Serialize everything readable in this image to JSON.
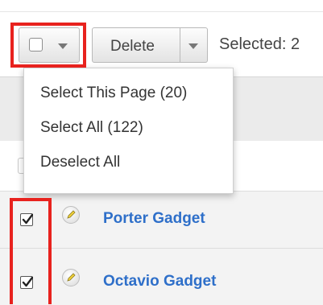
{
  "toolbar": {
    "delete_label": "Delete",
    "selected_text": "Selected: 2"
  },
  "mass_select_menu": {
    "items": [
      {
        "label": "Select This Page (20)"
      },
      {
        "label": "Select All (122)"
      },
      {
        "label": "Deselect All"
      }
    ]
  },
  "records": [
    {
      "name": "Porter Gadget",
      "checked": true
    },
    {
      "name": "Octavio Gadget",
      "checked": true
    }
  ],
  "colors": {
    "highlight": "#e8221e",
    "link": "#2e6fc9"
  }
}
